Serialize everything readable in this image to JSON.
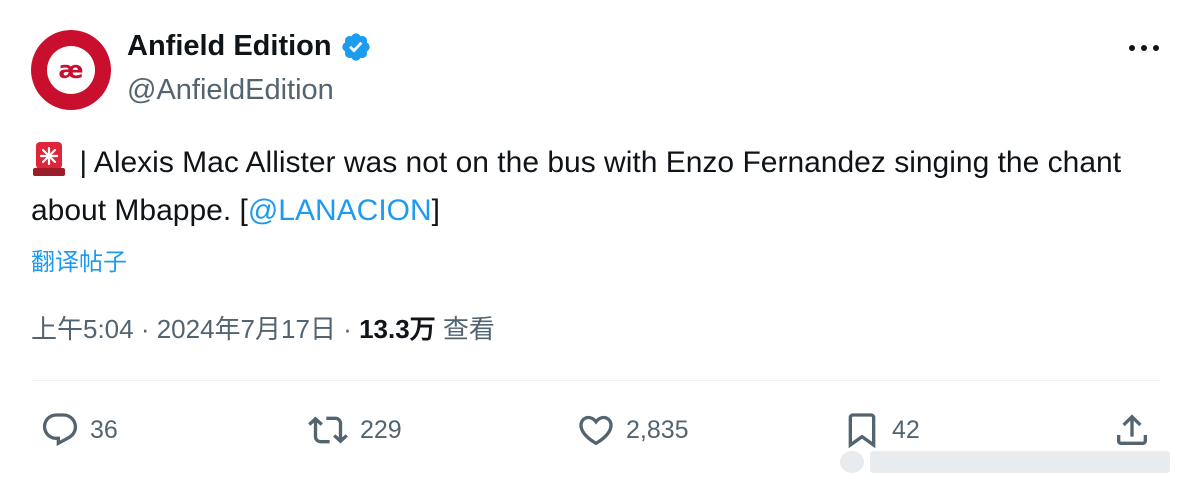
{
  "author": {
    "display_name": "Anfield Edition",
    "handle": "@AnfieldEdition",
    "avatar_text": "æ"
  },
  "tweet": {
    "text_main": " | Alexis Mac Allister was not on the bus with Enzo Fernandez singing the chant about Mbappe. [",
    "mention": "@LANACION",
    "text_end": "]",
    "translate_label": "翻译帖子"
  },
  "meta": {
    "time": "上午5:04",
    "separator": " · ",
    "date": "2024年7月17日",
    "views_count": "13.3万",
    "views_label": " 查看"
  },
  "actions": {
    "replies": "36",
    "retweets": "229",
    "likes": "2,835",
    "bookmarks": "42"
  },
  "colors": {
    "accent": "#1d9bf0",
    "avatar": "#c8102e",
    "muted": "#536471"
  }
}
